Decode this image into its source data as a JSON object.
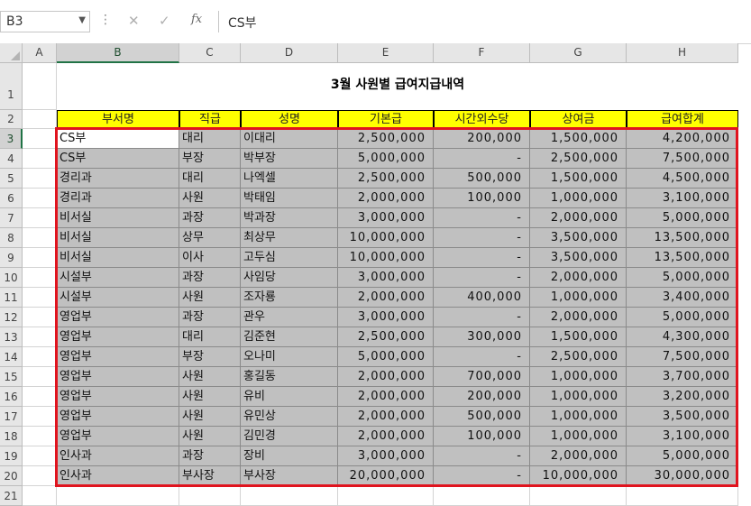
{
  "name_box": "B3",
  "formula_value": "CS부",
  "fx_label": "fx",
  "columns": [
    "A",
    "B",
    "C",
    "D",
    "E",
    "F",
    "G",
    "H"
  ],
  "rows": [
    "1",
    "2",
    "3",
    "4",
    "5",
    "6",
    "7",
    "8",
    "9",
    "10",
    "11",
    "12",
    "13",
    "14",
    "15",
    "16",
    "17",
    "18",
    "19",
    "20",
    "21"
  ],
  "title": "3월  사원별  급여지급내역",
  "headers": [
    "부서명",
    "직급",
    "성명",
    "기본급",
    "시간외수당",
    "상여금",
    "급여합계"
  ],
  "table": [
    [
      "CS부",
      "대리",
      "이대리",
      "2,500,000",
      "200,000",
      "1,500,000",
      "4,200,000"
    ],
    [
      "CS부",
      "부장",
      "박부장",
      "5,000,000",
      "-",
      "2,500,000",
      "7,500,000"
    ],
    [
      "경리과",
      "대리",
      "나엑셀",
      "2,500,000",
      "500,000",
      "1,500,000",
      "4,500,000"
    ],
    [
      "경리과",
      "사원",
      "박태임",
      "2,000,000",
      "100,000",
      "1,000,000",
      "3,100,000"
    ],
    [
      "비서실",
      "과장",
      "박과장",
      "3,000,000",
      "-",
      "2,000,000",
      "5,000,000"
    ],
    [
      "비서실",
      "상무",
      "최상무",
      "10,000,000",
      "-",
      "3,500,000",
      "13,500,000"
    ],
    [
      "비서실",
      "이사",
      "고두심",
      "10,000,000",
      "-",
      "3,500,000",
      "13,500,000"
    ],
    [
      "시설부",
      "과장",
      "사임당",
      "3,000,000",
      "-",
      "2,000,000",
      "5,000,000"
    ],
    [
      "시설부",
      "사원",
      "조자룡",
      "2,000,000",
      "400,000",
      "1,000,000",
      "3,400,000"
    ],
    [
      "영업부",
      "과장",
      "관우",
      "3,000,000",
      "-",
      "2,000,000",
      "5,000,000"
    ],
    [
      "영업부",
      "대리",
      "김준현",
      "2,500,000",
      "300,000",
      "1,500,000",
      "4,300,000"
    ],
    [
      "영업부",
      "부장",
      "오나미",
      "5,000,000",
      "-",
      "2,500,000",
      "7,500,000"
    ],
    [
      "영업부",
      "사원",
      "홍길동",
      "2,000,000",
      "700,000",
      "1,000,000",
      "3,700,000"
    ],
    [
      "영업부",
      "사원",
      "유비",
      "2,000,000",
      "200,000",
      "1,000,000",
      "3,200,000"
    ],
    [
      "영업부",
      "사원",
      "유민상",
      "2,000,000",
      "500,000",
      "1,000,000",
      "3,500,000"
    ],
    [
      "영업부",
      "사원",
      "김민경",
      "2,000,000",
      "100,000",
      "1,000,000",
      "3,100,000"
    ],
    [
      "인사과",
      "과장",
      "장비",
      "3,000,000",
      "-",
      "2,000,000",
      "5,000,000"
    ],
    [
      "인사과",
      "부사장",
      "부사장",
      "20,000,000",
      "-",
      "10,000,000",
      "30,000,000"
    ]
  ],
  "colors": {
    "header_fill": "#ffff00",
    "data_fill": "#c0c0c0",
    "highlight_border": "#e0141e",
    "selection": "#217346"
  }
}
